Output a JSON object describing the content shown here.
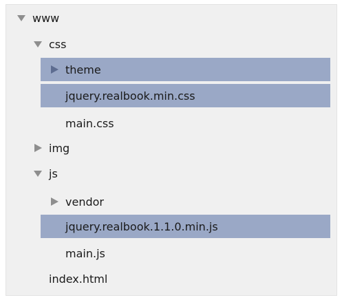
{
  "tree": {
    "colors": {
      "panel_bg": "#f0f0f0",
      "selection_bg": "#9aa8c6",
      "arrow": "#8e8e8e",
      "arrow_selected": "#5d6c90",
      "text": "#1a1a1a"
    },
    "items": [
      {
        "label": "www",
        "expanded": true,
        "folder": true,
        "selected": false,
        "icon": "triangle-down-icon"
      },
      {
        "label": "css",
        "expanded": true,
        "folder": true,
        "selected": false,
        "icon": "triangle-down-icon"
      },
      {
        "label": "theme",
        "expanded": false,
        "folder": true,
        "selected": true,
        "icon": "triangle-right-icon"
      },
      {
        "label": "jquery.realbook.min.css",
        "folder": false,
        "selected": true
      },
      {
        "label": "main.css",
        "folder": false,
        "selected": false
      },
      {
        "label": "img",
        "expanded": false,
        "folder": true,
        "selected": false,
        "icon": "triangle-right-icon"
      },
      {
        "label": "js",
        "expanded": true,
        "folder": true,
        "selected": false,
        "icon": "triangle-down-icon"
      },
      {
        "label": "vendor",
        "expanded": false,
        "folder": true,
        "selected": false,
        "icon": "triangle-right-icon"
      },
      {
        "label": "jquery.realbook.1.1.0.min.js",
        "folder": false,
        "selected": true
      },
      {
        "label": "main.js",
        "folder": false,
        "selected": false
      },
      {
        "label": "index.html",
        "folder": false,
        "selected": false
      }
    ]
  }
}
